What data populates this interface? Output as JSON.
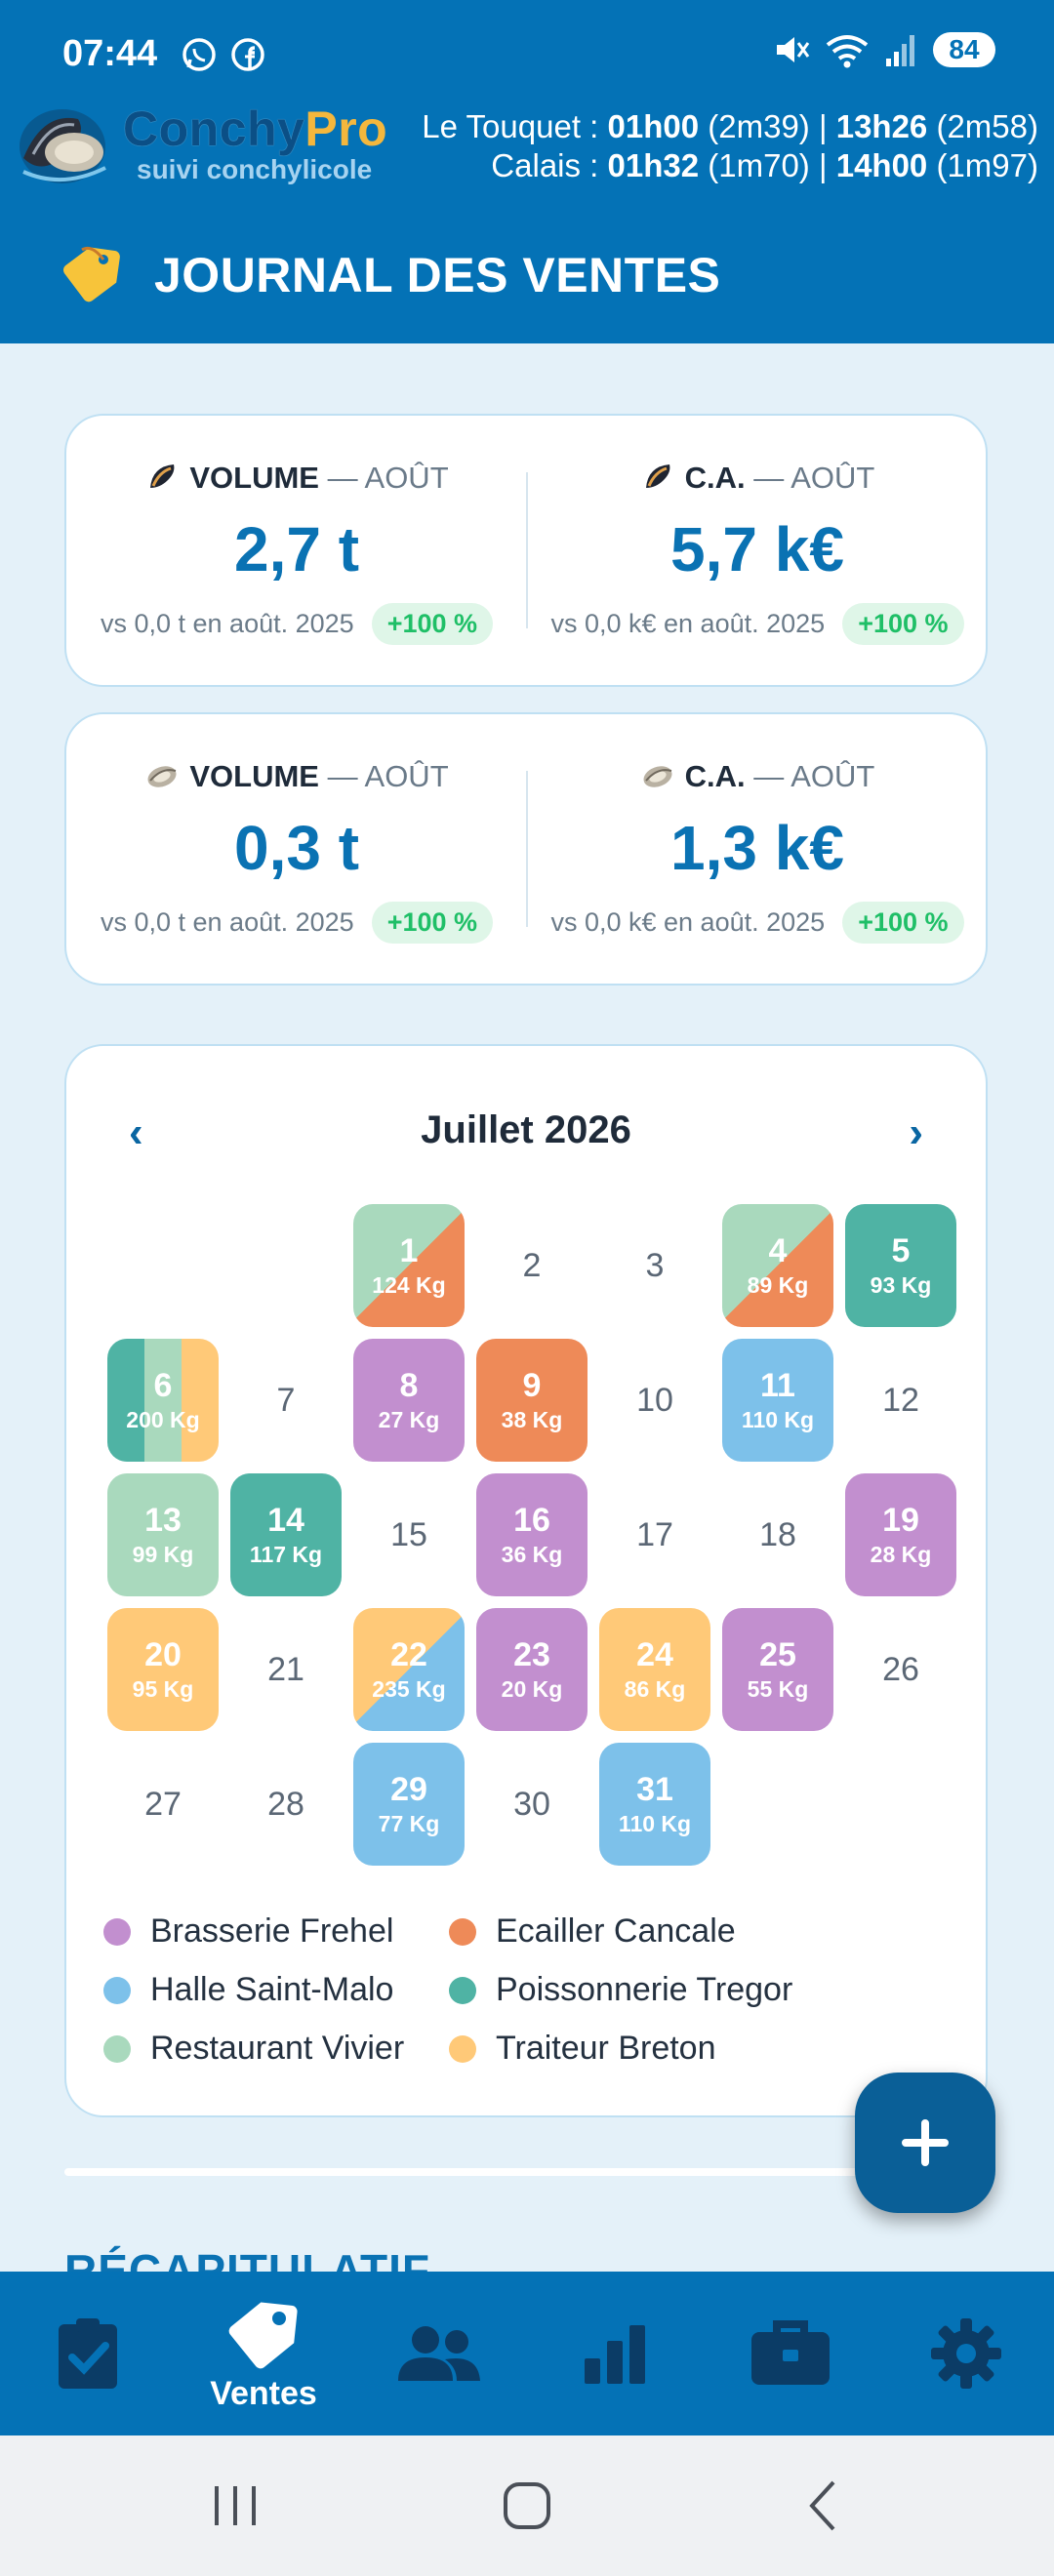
{
  "status": {
    "time": "07:44",
    "battery": "84"
  },
  "app": {
    "logo_main_1": "Conchy",
    "logo_main_2": "Pro",
    "logo_sub": "suivi conchylicole",
    "tides": [
      {
        "place": "Le Touquet :",
        "t1": "01h00",
        "h1": "(2m39)",
        "sep": "|",
        "t2": "13h26",
        "h2": "(2m58)"
      },
      {
        "place": "Calais :",
        "t1": "01h32",
        "h1": "(1m70)",
        "sep": "|",
        "t2": "14h00",
        "h2": "(1m97)"
      }
    ],
    "page_title": "JOURNAL DES VENTES"
  },
  "kpis": [
    {
      "left": {
        "label": "VOLUME",
        "month": "— AOÛT",
        "value": "2,7 t",
        "compare": "vs 0,0 t en août. 2025",
        "badge": "+100 %",
        "icon": "mussel-icon"
      },
      "right": {
        "label": "C.A.",
        "month": "— AOÛT",
        "value": "5,7 k€",
        "compare": "vs 0,0 k€ en août. 2025",
        "badge": "+100 %",
        "icon": "mussel-icon"
      }
    },
    {
      "left": {
        "label": "VOLUME",
        "month": "— AOÛT",
        "value": "0,3 t",
        "compare": "vs 0,0 t en août. 2025",
        "badge": "+100 %",
        "icon": "oyster-icon"
      },
      "right": {
        "label": "C.A.",
        "month": "— AOÛT",
        "value": "1,3 k€",
        "compare": "vs 0,0 k€ en août. 2025",
        "badge": "+100 %",
        "icon": "oyster-icon"
      }
    }
  ],
  "calendar": {
    "month_title": "Juillet 2026",
    "prev": "‹",
    "next": "›",
    "first_weekday_index": 2,
    "days": [
      {
        "d": "1",
        "w": "124 Kg",
        "c": [
          "Restaurant Vivier",
          "Ecailler Cancale"
        ]
      },
      {
        "d": "2"
      },
      {
        "d": "3"
      },
      {
        "d": "4",
        "w": "89 Kg",
        "c": [
          "Restaurant Vivier",
          "Ecailler Cancale"
        ]
      },
      {
        "d": "5",
        "w": "93 Kg",
        "c": [
          "Poissonnerie Tregor"
        ]
      },
      {
        "d": "6",
        "w": "200 Kg",
        "c": [
          "Poissonnerie Tregor",
          "Restaurant Vivier",
          "Traiteur Breton"
        ]
      },
      {
        "d": "7"
      },
      {
        "d": "8",
        "w": "27 Kg",
        "c": [
          "Brasserie Frehel"
        ]
      },
      {
        "d": "9",
        "w": "38 Kg",
        "c": [
          "Ecailler Cancale"
        ]
      },
      {
        "d": "10"
      },
      {
        "d": "11",
        "w": "110 Kg",
        "c": [
          "Halle Saint-Malo"
        ]
      },
      {
        "d": "12"
      },
      {
        "d": "13",
        "w": "99 Kg",
        "c": [
          "Restaurant Vivier"
        ]
      },
      {
        "d": "14",
        "w": "117 Kg",
        "c": [
          "Poissonnerie Tregor"
        ]
      },
      {
        "d": "15"
      },
      {
        "d": "16",
        "w": "36 Kg",
        "c": [
          "Brasserie Frehel"
        ]
      },
      {
        "d": "17"
      },
      {
        "d": "18"
      },
      {
        "d": "19",
        "w": "28 Kg",
        "c": [
          "Brasserie Frehel"
        ]
      },
      {
        "d": "20",
        "w": "95 Kg",
        "c": [
          "Traiteur Breton"
        ]
      },
      {
        "d": "21"
      },
      {
        "d": "22",
        "w": "235 Kg",
        "c": [
          "Traiteur Breton",
          "Halle Saint-Malo"
        ]
      },
      {
        "d": "23",
        "w": "20 Kg",
        "c": [
          "Brasserie Frehel"
        ]
      },
      {
        "d": "24",
        "w": "86 Kg",
        "c": [
          "Traiteur Breton"
        ]
      },
      {
        "d": "25",
        "w": "55 Kg",
        "c": [
          "Brasserie Frehel"
        ]
      },
      {
        "d": "26"
      },
      {
        "d": "27"
      },
      {
        "d": "28"
      },
      {
        "d": "29",
        "w": "77 Kg",
        "c": [
          "Halle Saint-Malo"
        ]
      },
      {
        "d": "30"
      },
      {
        "d": "31",
        "w": "110 Kg",
        "c": [
          "Halle Saint-Malo"
        ]
      }
    ]
  },
  "legend": [
    {
      "name": "Brasserie Frehel",
      "color": "#c28fcf"
    },
    {
      "name": "Ecailler Cancale",
      "color": "#ee8a58"
    },
    {
      "name": "Halle Saint-Malo",
      "color": "#7dc1ea"
    },
    {
      "name": "Poissonnerie Tregor",
      "color": "#4fb3a4"
    },
    {
      "name": "Restaurant Vivier",
      "color": "#a9d9bd"
    },
    {
      "name": "Traiteur Breton",
      "color": "#ffc978"
    }
  ],
  "recap_title": "RÉCAPITULATIF",
  "nav": [
    {
      "name": "nav-tasks",
      "icon": "clipboard-check-icon",
      "label": ""
    },
    {
      "name": "nav-sales",
      "icon": "tag-icon",
      "label": "Ventes"
    },
    {
      "name": "nav-clients",
      "icon": "users-icon",
      "label": ""
    },
    {
      "name": "nav-stats",
      "icon": "bar-chart-icon",
      "label": ""
    },
    {
      "name": "nav-stock",
      "icon": "briefcase-icon",
      "label": ""
    },
    {
      "name": "nav-settings",
      "icon": "gear-icon",
      "label": ""
    }
  ],
  "colors": {
    "primary": "#0472b6",
    "accent": "#0a72b3",
    "background": "#e4f1f9",
    "positive": "#1fbf67"
  }
}
